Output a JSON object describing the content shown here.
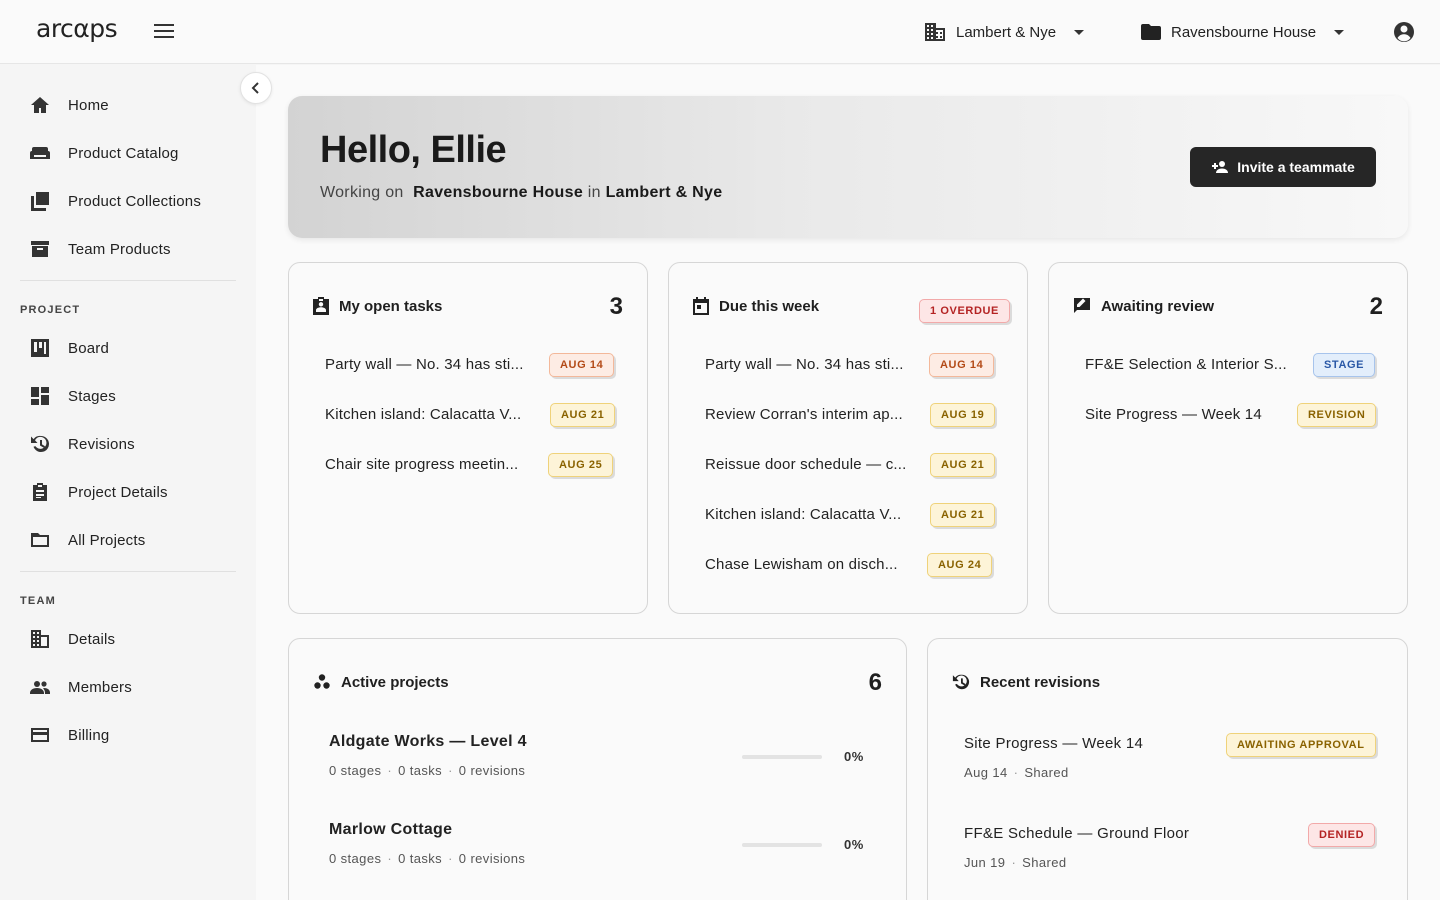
{
  "app": {
    "logo": "arcαps"
  },
  "topbar": {
    "company": "Lambert & Nye",
    "project": "Ravensbourne House"
  },
  "sidebar": {
    "main_items": [
      {
        "label": "Home",
        "icon": "home-icon"
      },
      {
        "label": "Product Catalog",
        "icon": "sofa-icon"
      },
      {
        "label": "Product Collections",
        "icon": "collections-icon"
      },
      {
        "label": "Team Products",
        "icon": "archive-icon"
      }
    ],
    "project_section": "PROJECT",
    "project_items": [
      {
        "label": "Board",
        "icon": "board-icon"
      },
      {
        "label": "Stages",
        "icon": "dashboard-icon"
      },
      {
        "label": "Revisions",
        "icon": "history-icon"
      },
      {
        "label": "Project Details",
        "icon": "clipboard-icon"
      },
      {
        "label": "All Projects",
        "icon": "folder-icon"
      }
    ],
    "team_section": "TEAM",
    "team_items": [
      {
        "label": "Details",
        "icon": "building-icon"
      },
      {
        "label": "Members",
        "icon": "people-icon"
      },
      {
        "label": "Billing",
        "icon": "credit-card-icon"
      }
    ]
  },
  "hero": {
    "greeting": "Hello, Ellie",
    "working_on": "Working on",
    "project": "Ravensbourne House",
    "in": "in",
    "company": "Lambert & Nye",
    "invite_label": "Invite a teammate"
  },
  "open_tasks": {
    "title": "My open tasks",
    "count": "3",
    "items": [
      {
        "text": "Party wall — No. 34 has sti...",
        "due": "AUG 14",
        "tone": "orange"
      },
      {
        "text": "Kitchen island: Calacatta V...",
        "due": "AUG 21",
        "tone": "yellow"
      },
      {
        "text": "Chair site progress meetin...",
        "due": "AUG 25",
        "tone": "yellow"
      }
    ]
  },
  "due_week": {
    "title": "Due this week",
    "overdue": "1 OVERDUE",
    "items": [
      {
        "text": "Party wall — No. 34 has sti...",
        "due": "AUG 14",
        "tone": "orange"
      },
      {
        "text": "Review Corran's interim ap...",
        "due": "AUG 19",
        "tone": "yellow"
      },
      {
        "text": "Reissue door schedule — c...",
        "due": "AUG 21",
        "tone": "yellow"
      },
      {
        "text": "Kitchen island: Calacatta V...",
        "due": "AUG 21",
        "tone": "yellow"
      },
      {
        "text": "Chase Lewisham on disch...",
        "due": "AUG 24",
        "tone": "yellow"
      }
    ]
  },
  "awaiting_review": {
    "title": "Awaiting review",
    "count": "2",
    "items": [
      {
        "text": "FF&E Selection & Interior S...",
        "tag": "STAGE",
        "tone": "blue"
      },
      {
        "text": "Site Progress — Week 14",
        "tag": "REVISION",
        "tone": "yellow"
      }
    ]
  },
  "active_projects": {
    "title": "Active projects",
    "count": "6",
    "items": [
      {
        "name": "Aldgate Works — Level 4",
        "stages": "0 stages",
        "tasks": "0 tasks",
        "revisions": "0 revisions",
        "progress": 0,
        "pct": "0%"
      },
      {
        "name": "Marlow Cottage",
        "stages": "0 stages",
        "tasks": "0 tasks",
        "revisions": "0 revisions",
        "progress": 0,
        "pct": "0%"
      }
    ]
  },
  "recent_revisions": {
    "title": "Recent revisions",
    "items": [
      {
        "name": "Site Progress — Week 14",
        "date": "Aug 14",
        "visibility": "Shared",
        "status": "AWAITING APPROVAL",
        "tone": "yellow"
      },
      {
        "name": "FF&E Schedule — Ground Floor",
        "date": "Jun 19",
        "visibility": "Shared",
        "status": "DENIED",
        "tone": "red"
      }
    ]
  },
  "colors": {
    "accent_dark": "#262626",
    "orange": "#b34a17",
    "yellow": "#8a6200",
    "red": "#b42323",
    "blue": "#2a58a6"
  }
}
